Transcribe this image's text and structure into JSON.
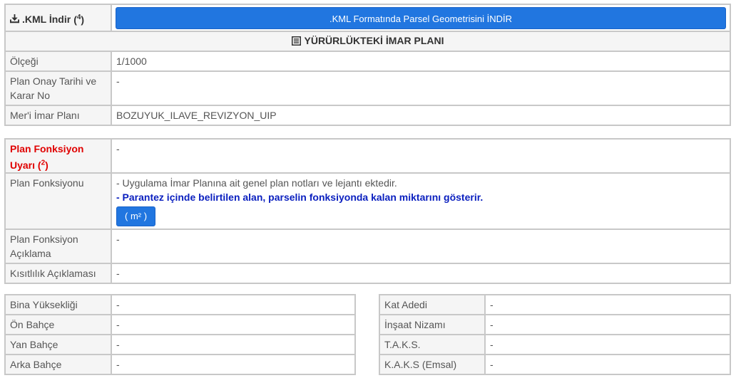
{
  "kml": {
    "label": ".KML İndir",
    "label_sup": "4",
    "button_label": ".KML Formatında Parsel Geometrisini İNDİR"
  },
  "imar": {
    "section_title": "YÜRÜRLÜKTEKİ İMAR PLANI",
    "rows": [
      {
        "label": "Ölçeği",
        "value": "1/1000"
      },
      {
        "label": "Plan Onay Tarihi ve Karar No",
        "value": "-"
      },
      {
        "label": "Mer'i İmar Planı",
        "value": "BOZUYUK_ILAVE_REVIZYON_UIP"
      }
    ]
  },
  "fonksiyon": {
    "warning_label": "Plan Fonksiyon Uyarı",
    "warning_sup": "2",
    "warning_value": "-",
    "plan_label": "Plan Fonksiyonu",
    "plan_text": "- Uygulama İmar Planına ait genel plan notları ve lejantı ektedir.",
    "plan_note": "- Parantez içinde belirtilen alan, parselin fonksiyonda kalan miktarını gösterir.",
    "m2_button": "( m² )",
    "aciklama_label": "Plan Fonksiyon Açıklama",
    "aciklama_value": "-",
    "kisitlilik_label": "Kısıtlılık Açıklaması",
    "kisitlilik_value": "-"
  },
  "left_table": [
    {
      "label": "Bina Yüksekliği",
      "value": "-"
    },
    {
      "label": "Ön Bahçe",
      "value": "-"
    },
    {
      "label": "Yan Bahçe",
      "value": "-"
    },
    {
      "label": "Arka Bahçe",
      "value": "-"
    }
  ],
  "right_table": [
    {
      "label": "Kat Adedi",
      "value": "-"
    },
    {
      "label": "İnşaat Nizamı",
      "value": "-"
    },
    {
      "label": "T.A.K.S.",
      "value": "-"
    },
    {
      "label": "K.A.K.S (Emsal)",
      "value": "-"
    }
  ]
}
